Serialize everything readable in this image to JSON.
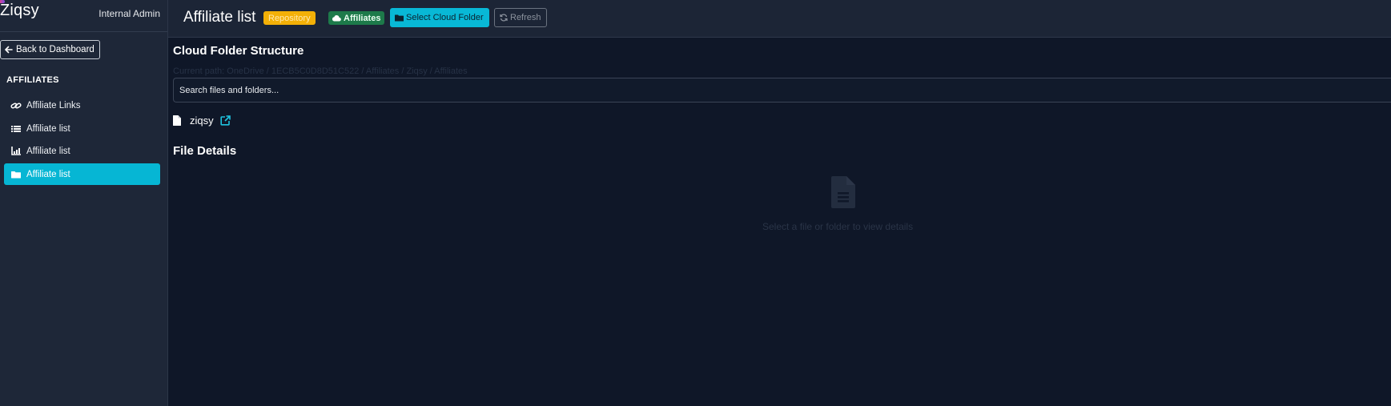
{
  "sidebar": {
    "brand": "Ziqsy",
    "role": "Internal Admin",
    "back_label": "Back to Dashboard",
    "section_title": "AFFILIATES",
    "items": [
      {
        "label": "Affiliate Links",
        "icon": "link-icon",
        "active": false
      },
      {
        "label": "Affiliate list",
        "icon": "list-icon",
        "active": false
      },
      {
        "label": "Affiliate list",
        "icon": "chart-icon",
        "active": false
      },
      {
        "label": "Affiliate list",
        "icon": "folder-icon",
        "active": true
      }
    ]
  },
  "header": {
    "title": "Affiliate list",
    "badge_repository": "Repository",
    "badge_affiliates": "Affiliates",
    "select_folder_label": "Select Cloud Folder",
    "refresh_label": "Refresh"
  },
  "main": {
    "structure_heading": "Cloud Folder Structure",
    "structure_subtext": "Current path: OneDrive / 1ECB5C0D8D51C522 / Affiliates / Ziqsy / Affiliates",
    "search_placeholder": "Search files and folders...",
    "tree": [
      {
        "name": "ziqsy",
        "icon": "file-icon",
        "action_icon": "external-link-icon"
      }
    ],
    "details_heading": "File Details",
    "details_empty": "Select a file or folder to view details"
  },
  "colors": {
    "background": "#0f1728",
    "sidebar": "#1e2738",
    "accent": "#06b6d4",
    "repository_badge": "#f3b007",
    "affiliates_badge": "#1d7a4a"
  }
}
